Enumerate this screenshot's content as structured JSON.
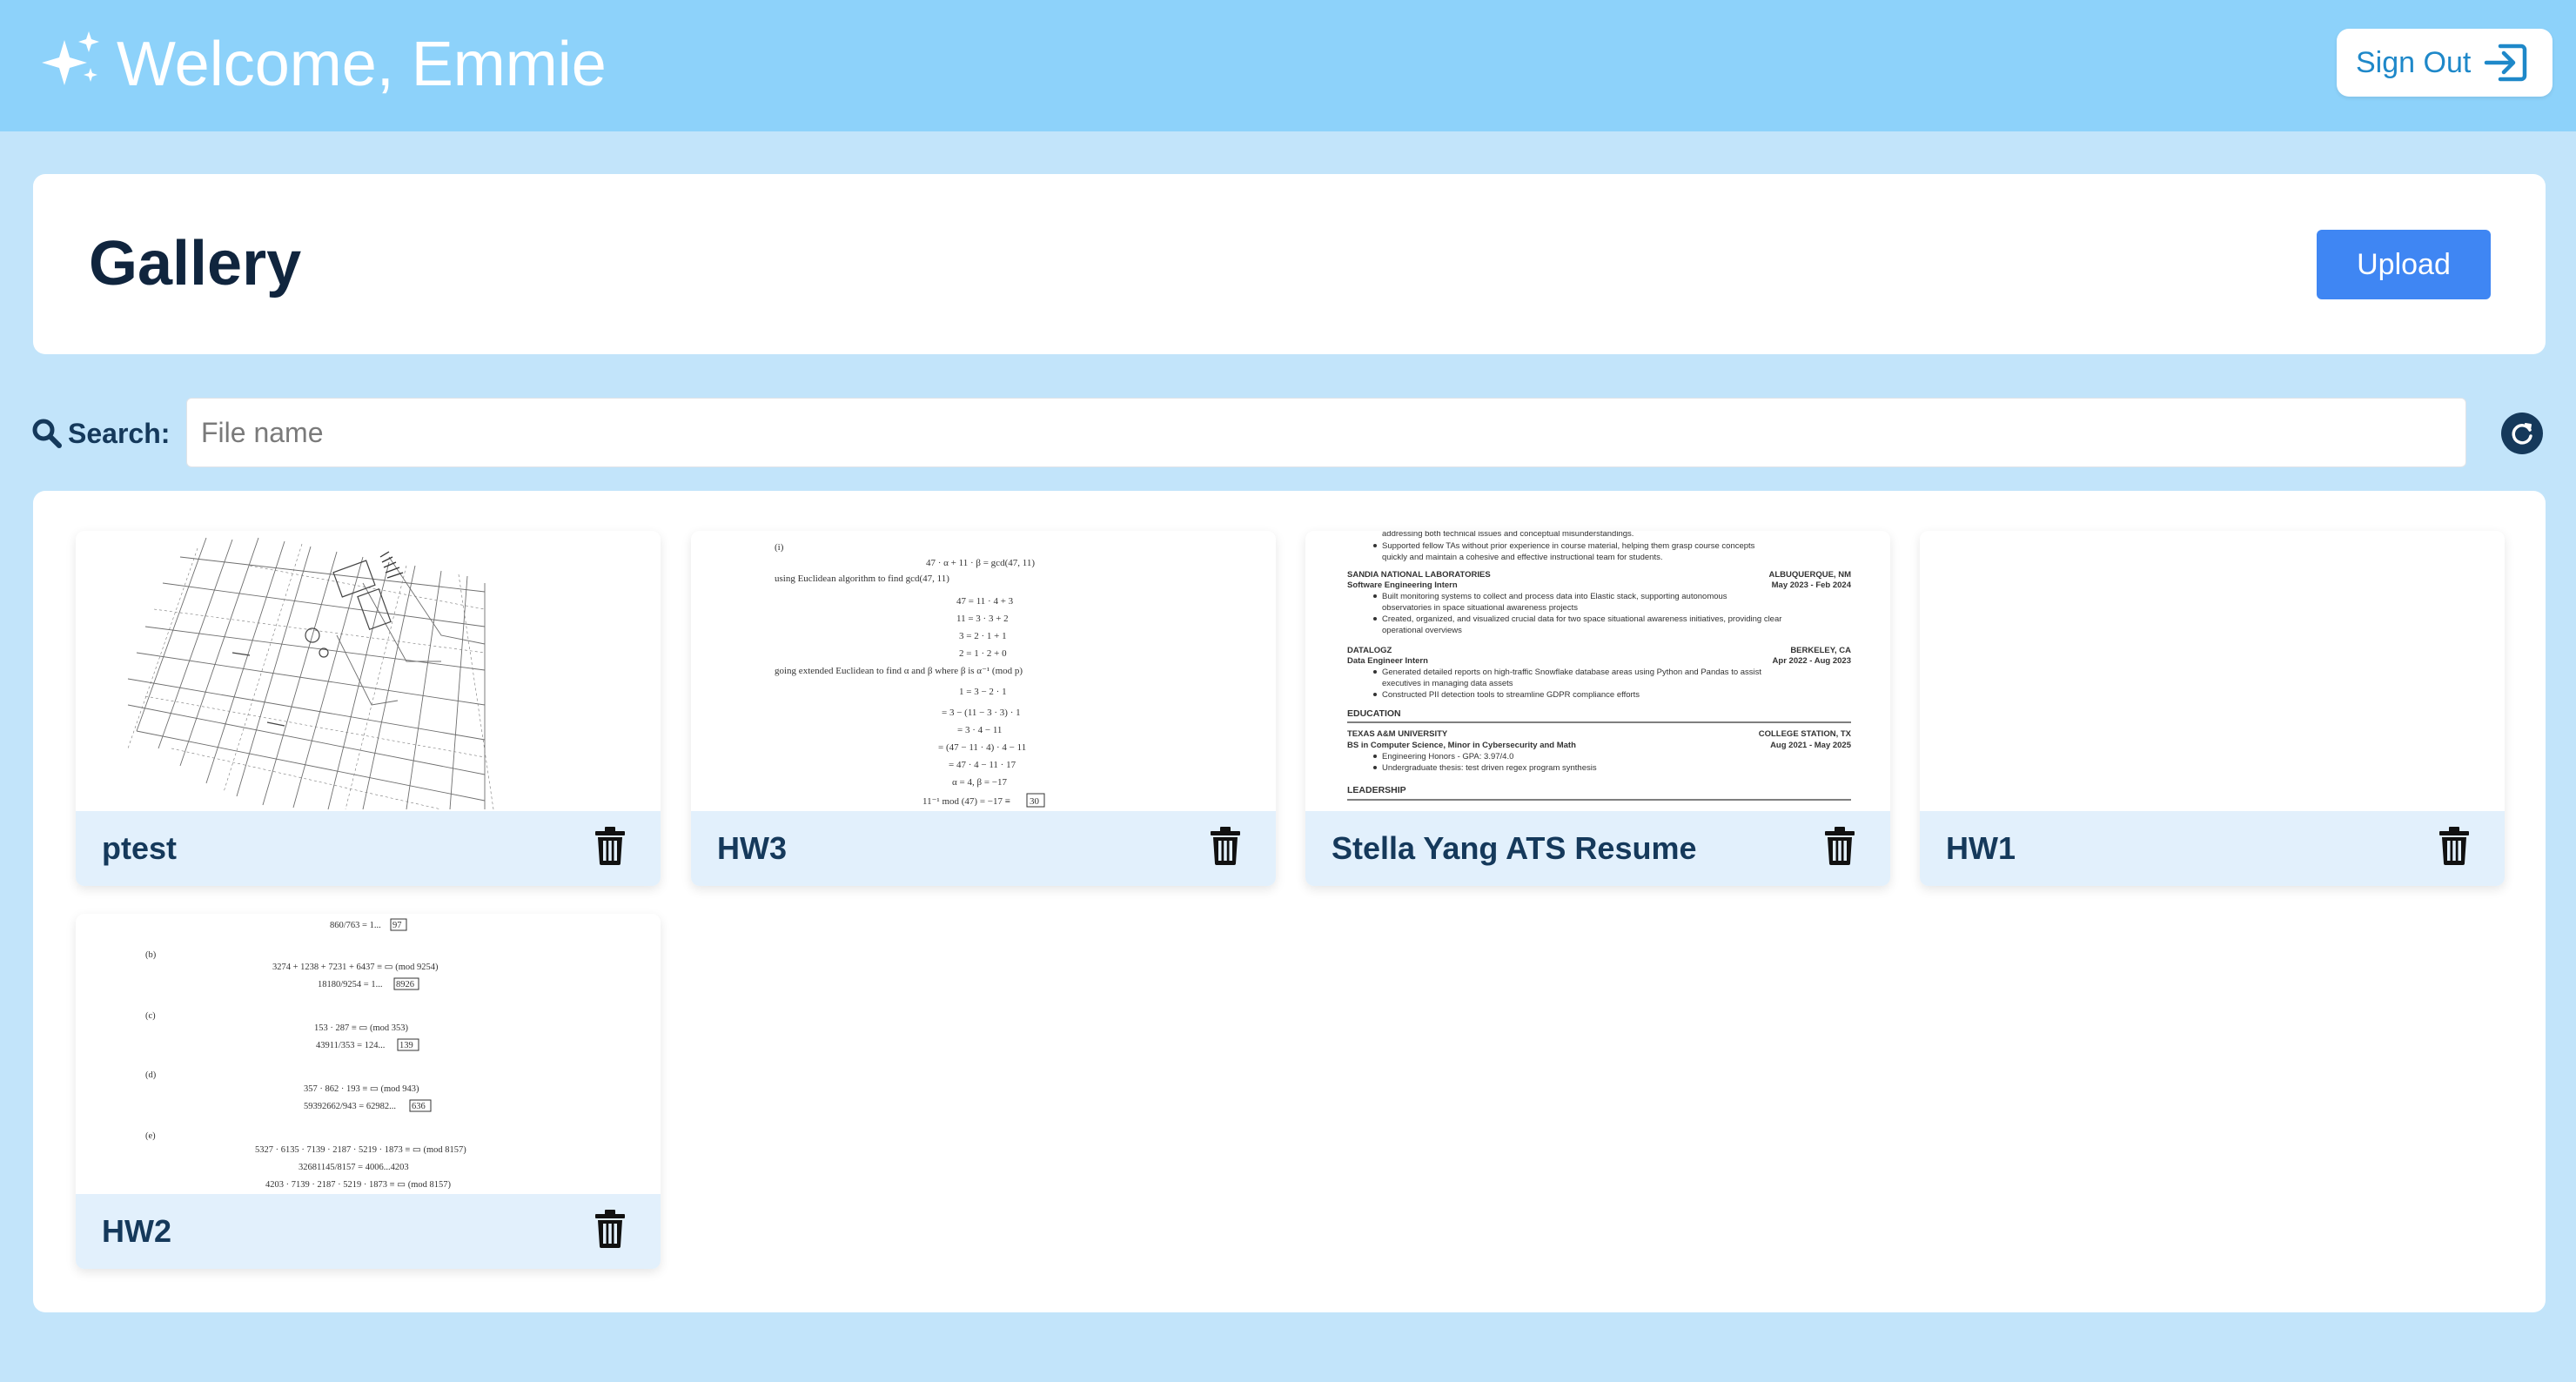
{
  "header": {
    "welcome_text": "Welcome, Emmie",
    "sign_out_label": "Sign Out",
    "icons": {
      "logo": "sparkles-icon",
      "sign_out": "sign-out-icon"
    },
    "colors": {
      "bar": "#8dd2fa",
      "accent": "#1e88c9"
    }
  },
  "gallery": {
    "title": "Gallery",
    "upload_label": "Upload",
    "upload_color": "#3f86f3"
  },
  "search": {
    "label": "Search:",
    "placeholder": "File name",
    "value": "",
    "icons": {
      "search": "search-icon",
      "refresh": "refresh-icon"
    }
  },
  "files": [
    {
      "name": "ptest",
      "preview": "architectural-plan"
    },
    {
      "name": "HW3",
      "preview": "math-document"
    },
    {
      "name": "Stella Yang ATS Resume",
      "preview": "resume-document"
    },
    {
      "name": "HW1",
      "preview": "blank"
    },
    {
      "name": "HW2",
      "preview": "math-document"
    }
  ],
  "previews": {
    "hw3": {
      "lines": [
        "(i)",
        "47 · α + 11 · β = gcd(47, 11)",
        "using Euclidean algorithm to find gcd(47, 11)",
        "47 = 11 · 4 + 3",
        "11 = 3 · 3 + 2",
        "3 = 2 · 1 + 1",
        "2 = 1 · 2 + 0",
        "going extended Euclidean to find α and β where β is α⁻¹ (mod p)",
        "1 = 3 − 2 · 1",
        "= 3 − (11 − 3 · 3) · 1",
        "= 3 · 4 − 11",
        "= (47 − 11 · 4) · 4 − 11",
        "= 47 · 4 − 11 · 17",
        "α = 4, β = −17",
        "11⁻¹ mod (47) = −17 ≡",
        "30"
      ]
    },
    "resume": {
      "lines": [
        "addressing both technical issues and conceptual misunderstandings.",
        "Supported fellow TAs without prior experience in course material, helping them grasp course concepts",
        "quickly and maintain a cohesive and effective instructional team for students.",
        "SANDIA NATIONAL LABORATORIES",
        "ALBUQUERQUE, NM",
        "Software Engineering Intern",
        "May 2023 - Feb 2024",
        "Built monitoring systems to collect and process data into Elastic stack, supporting autonomous",
        "observatories in space situational awareness projects",
        "Created, organized, and visualized crucial data for two space situational awareness initiatives, providing clear",
        "operational overviews",
        "DATALOGZ",
        "BERKELEY, CA",
        "Data Engineer Intern",
        "Apr 2022 - Aug 2023",
        "Generated detailed reports on high-traffic Snowflake database areas using Python and Pandas to assist",
        "executives in managing data assets",
        "Constructed PII detection tools to streamline GDPR compliance efforts",
        "EDUCATION",
        "TEXAS A&M UNIVERSITY",
        "COLLEGE STATION, TX",
        "BS in Computer Science, Minor in Cybersecurity and Math",
        "Aug 2021 - May 2025",
        "Engineering Honors - GPA: 3.97/4.0",
        "Undergraduate thesis: test driven regex program synthesis",
        "LEADERSHIP"
      ]
    },
    "hw2": {
      "lines": [
        "860/763 = 1...",
        "97",
        "(b)",
        "3274 + 1238 + 7231 + 6437 ≡ ▭ (mod 9254)",
        "18180/9254 = 1...",
        "8926",
        "(c)",
        "153 · 287 ≡ ▭ (mod 353)",
        "43911/353 = 124...",
        "139",
        "(d)",
        "357 · 862 · 193 ≡ ▭ (mod 943)",
        "59392662/943 = 62982...",
        "636",
        "(e)",
        "5327 · 6135 · 7139 · 2187 · 5219 · 1873 ≡ ▭ (mod 8157)",
        "32681145/8157 = 4006...4203",
        "4203 · 7139 · 2187 · 5219 · 1873 ≡ ▭ (mod 8157)"
      ]
    }
  }
}
